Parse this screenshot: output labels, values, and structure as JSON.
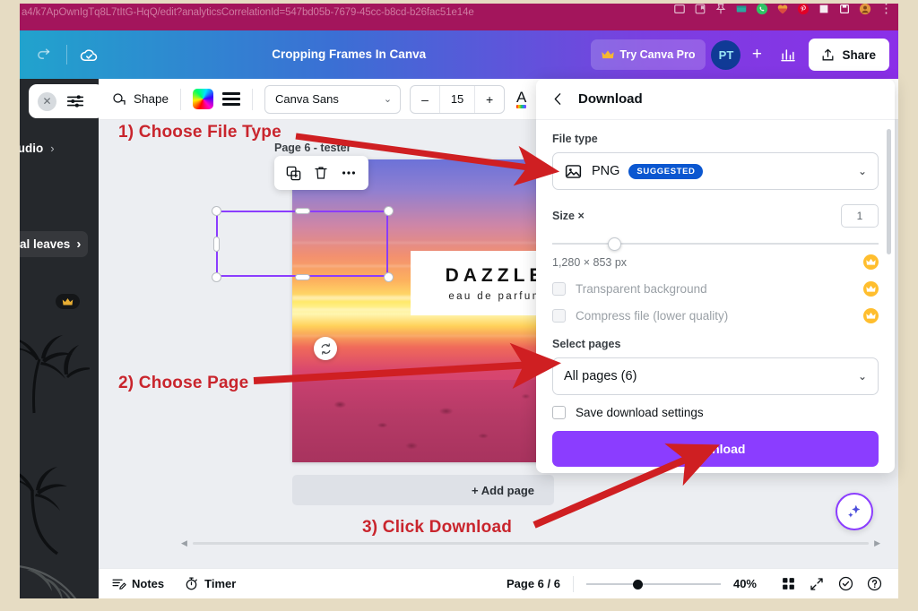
{
  "browser": {
    "url": "a4/k7ApOwnIgTq8L7tItG-HqQ/edit?analyticsCorrelationId=547bd05b-7679-45cc-b8cd-b26fac51e14e",
    "icons": [
      "window-icon",
      "bookmark-icon",
      "pin-icon",
      "extension-green-icon",
      "whatsapp-icon",
      "heart-icon",
      "pinterest-icon",
      "grammarly-icon",
      "save-icon",
      "profile-icon"
    ],
    "menu_dots": "⋮"
  },
  "header": {
    "redo_icon": "redo-icon",
    "saved_icon": "cloud-check-icon",
    "title": "Cropping Frames In Canva",
    "try_pro_label": "Try Canva Pro",
    "crown_icon": "crown-icon",
    "avatar_initials": "PT",
    "plus_label": "+",
    "analytics_icon": "analytics-bar-chart-icon",
    "share_label": "Share",
    "share_icon": "upload-icon"
  },
  "sidebar": {
    "close_icon": "close-icon",
    "filter_icon": "sliders-icon",
    "audio_label": "Audio",
    "audio_chevron": "›",
    "tropical_label": "al leaves",
    "tropical_chevron": "›",
    "collapse_icon": "‹"
  },
  "toolbar": {
    "shape_label": "Shape",
    "shape_icon": "shape-icon",
    "color_swatch": "rainbow-color-swatch",
    "align_icon": "align-lines-icon",
    "font_name": "Canva Sans",
    "font_chevron": "⌄",
    "size_minus": "–",
    "size_value": "15",
    "size_plus": "+",
    "text_color_icon": "text-color-A-icon"
  },
  "canvas": {
    "page_label": "Page 6 - tester",
    "design": {
      "brand": "DAZZLE",
      "subtitle": "eau de parfum"
    },
    "object_toolbar": {
      "duplicate_icon": "duplicate-icon",
      "delete_icon": "trash-icon",
      "more_icon": "more-dots-icon"
    },
    "rotate_icon": "rotate-icon",
    "add_page_label": "+ Add page",
    "magic_icon": "magic-sparkle-icon"
  },
  "download_panel": {
    "back_icon": "back-chevron-icon",
    "title": "Download",
    "file_type_label": "File type",
    "file_type_icon": "image-icon",
    "file_type_value": "PNG",
    "suggested_badge": "SUGGESTED",
    "file_type_chevron": "⌄",
    "size_label": "Size ×",
    "size_value": "1",
    "dimensions": "1,280 × 853 px",
    "transparent_label": "Transparent background",
    "compress_label": "Compress file (lower quality)",
    "crown_icon": "crown-icon",
    "select_pages_label": "Select pages",
    "pages_value": "All pages (6)",
    "pages_chevron": "⌄",
    "save_settings_label": "Save download settings",
    "download_button": "Download"
  },
  "bottom_bar": {
    "notes_label": "Notes",
    "notes_icon": "notes-pencil-icon",
    "timer_label": "Timer",
    "timer_icon": "stopwatch-icon",
    "page_indicator": "Page 6 / 6",
    "zoom_value": "40%",
    "grid_icon": "grid-view-icon",
    "expand_icon": "expand-icon",
    "check_icon": "check-circle-icon",
    "help_icon": "help-circle-icon"
  },
  "annotations": {
    "step1": "1) Choose File Type",
    "step2": "2) Choose Page",
    "step3": "3) Click Download",
    "color": "#c9252d"
  }
}
